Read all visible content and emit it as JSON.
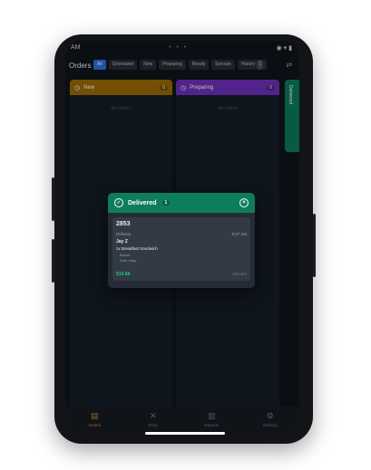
{
  "status": {
    "time": "AM",
    "center": "• • •",
    "right": "◉ ▾ ▮"
  },
  "header": {
    "title": "Orders",
    "filters": [
      {
        "label": "All",
        "active": true
      },
      {
        "label": "Scheduled"
      },
      {
        "label": "New"
      },
      {
        "label": "Preparing"
      },
      {
        "label": "Ready"
      },
      {
        "label": "Enroute"
      },
      {
        "label": "History",
        "count": "1"
      }
    ]
  },
  "columns": [
    {
      "label": "New",
      "count": "0",
      "empty": "No orders",
      "color": "#9a6a05"
    },
    {
      "label": "Preparing",
      "count": "0",
      "empty": "No orders",
      "color": "#6e2fb8"
    }
  ],
  "side_tab": {
    "label": "Delivered"
  },
  "dialog": {
    "title": "Delivered",
    "count": "1",
    "order": {
      "number": "2853",
      "type": "Delivery",
      "time": "9:27 AM",
      "customer": "Jay Z",
      "item": "1x Breakfast Sandwich",
      "mods": [
        "Bacon",
        "Over easy"
      ],
      "price": "$19.88",
      "ago": "Minutes"
    }
  },
  "nav": [
    {
      "label": "Orders",
      "icon": "receipt-icon",
      "active": true
    },
    {
      "label": "Shop",
      "icon": "utensils-icon"
    },
    {
      "label": "Reports",
      "icon": "chart-icon"
    },
    {
      "label": "Settings",
      "icon": "gear-icon"
    }
  ]
}
